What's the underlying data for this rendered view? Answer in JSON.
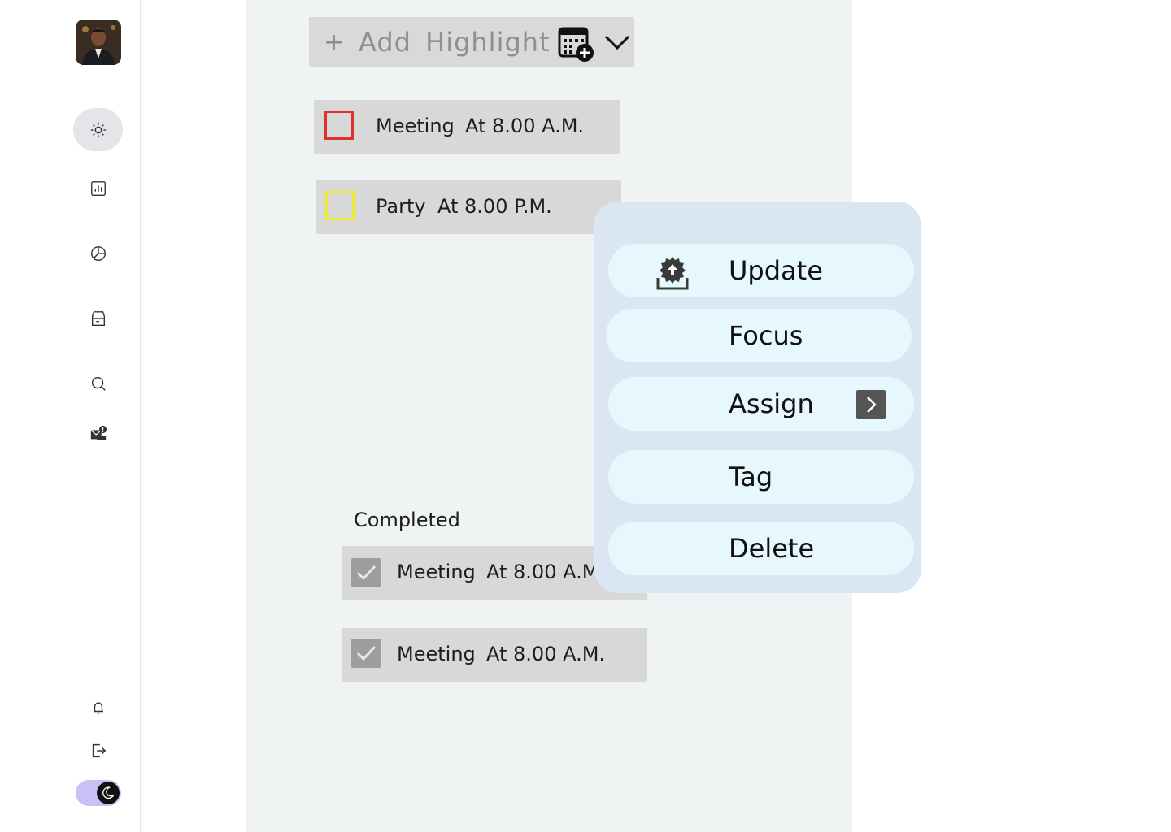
{
  "sidebar": {
    "avatar_alt": "user-avatar",
    "nav": [
      {
        "icon": "sun-icon"
      },
      {
        "icon": "bar-chart-icon"
      },
      {
        "icon": "pie-chart-icon"
      },
      {
        "icon": "archive-icon"
      },
      {
        "icon": "search-icon"
      },
      {
        "icon": "mail-alert-icon"
      }
    ],
    "bottom": [
      {
        "icon": "bell-icon"
      },
      {
        "icon": "logout-icon"
      }
    ],
    "theme_toggle": {
      "icon": "moon-icon",
      "state": "dark"
    }
  },
  "add_highlight": {
    "plus": "+",
    "label": "Add  Highlight"
  },
  "tasks": [
    {
      "name": "Meeting",
      "time": "At 8.00 A.M.",
      "box_color": "#e0322d"
    },
    {
      "name": "Party",
      "time": "At 8.00 P.M.",
      "box_color": "#f1ea2a"
    }
  ],
  "completed": {
    "heading": "Completed",
    "items": [
      {
        "name": "Meeting",
        "time": "At 8.00 A.M."
      },
      {
        "name": "Meeting",
        "time": "At 8.00 A.M."
      }
    ]
  },
  "context_menu": {
    "items": [
      {
        "label": "Update",
        "icon": "update-icon"
      },
      {
        "label": "Focus"
      },
      {
        "label": "Assign",
        "icon": "chevron-right-icon"
      },
      {
        "label": "Tag"
      },
      {
        "label": "Delete"
      }
    ]
  },
  "colors": {
    "panel_bg": "#f0f3f4",
    "task_bg": "#d8d8d8",
    "menu_bg": "#dae7f3",
    "menu_item_bg": "#e6f8fd",
    "toggle_bg": "#c9c0f5"
  }
}
